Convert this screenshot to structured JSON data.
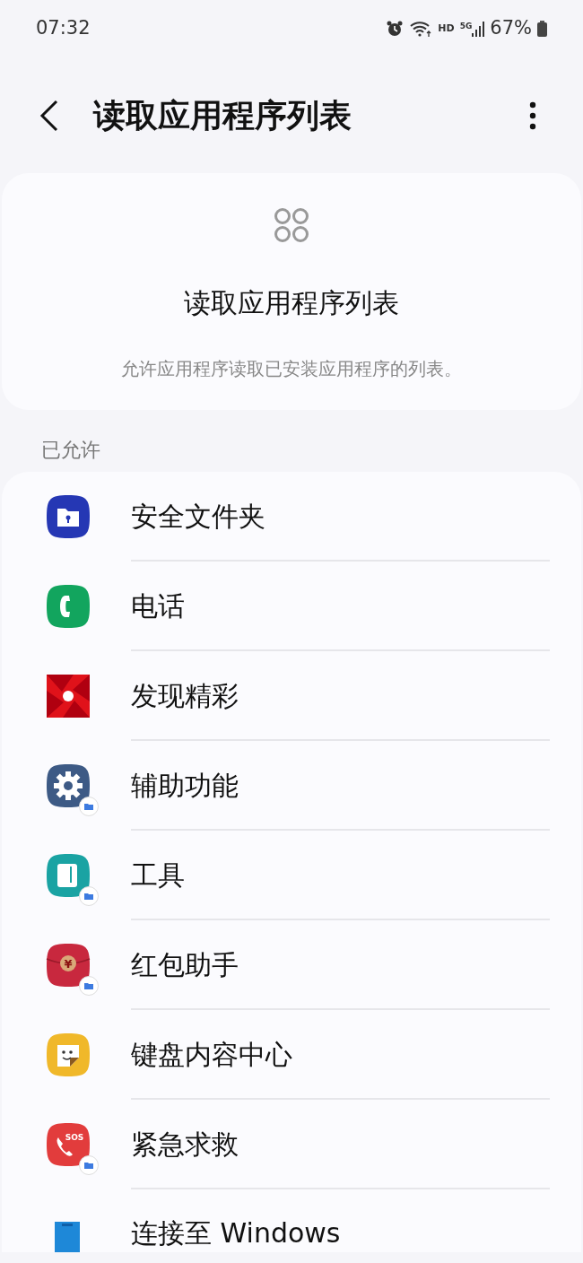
{
  "status_bar": {
    "time": "07:32",
    "network": "HD",
    "network_type": "5G",
    "battery": "67%"
  },
  "header": {
    "title": "读取应用程序列表"
  },
  "info_card": {
    "title": "读取应用程序列表",
    "description": "允许应用程序读取已安装应用程序的列表。"
  },
  "section_label": "已允许",
  "apps": [
    {
      "name": "安全文件夹",
      "kind": "folder",
      "color": "#2537b4",
      "badge": false
    },
    {
      "name": "电话",
      "kind": "phone",
      "color": "#12a55e",
      "badge": false
    },
    {
      "name": "发现精彩",
      "kind": "discover",
      "color": "#e0121a",
      "badge": false
    },
    {
      "name": "辅助功能",
      "kind": "gear",
      "color": "#3d5a85",
      "badge": true
    },
    {
      "name": "工具",
      "kind": "tool",
      "color": "#1aa3a3",
      "badge": true
    },
    {
      "name": "红包助手",
      "kind": "envelope",
      "color": "#c8283e",
      "badge": true,
      "icon_text": "¥"
    },
    {
      "name": "键盘内容中心",
      "kind": "sticker",
      "color": "#f0b82a",
      "badge": false
    },
    {
      "name": "紧急求救",
      "kind": "sos",
      "color": "#e23c3c",
      "badge": true,
      "icon_text": "SOS"
    },
    {
      "name": "连接至 Windows",
      "kind": "windows",
      "color": "#1e88d8",
      "badge": false
    }
  ]
}
